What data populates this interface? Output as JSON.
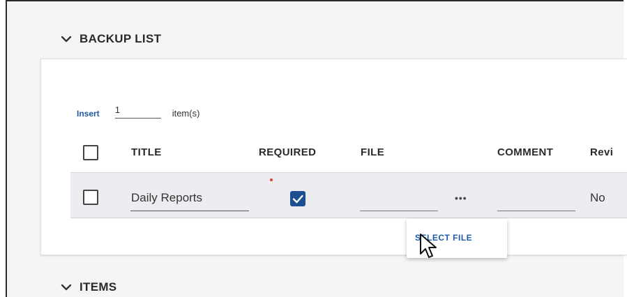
{
  "sections": {
    "backup_list": {
      "title": "BACKUP LIST"
    },
    "items": {
      "title": "ITEMS"
    }
  },
  "toolbar": {
    "insert_label": "Insert",
    "quantity_value": "1",
    "items_suffix": "item(s)"
  },
  "table": {
    "headers": [
      "TITLE",
      "REQUIRED",
      "FILE",
      "COMMENT",
      "Revi"
    ],
    "rows": [
      {
        "title": "Daily Reports",
        "required": true,
        "file": "",
        "file_menu": "•••",
        "comment": "",
        "review": "No"
      }
    ]
  },
  "popup": {
    "select_file_label": "SELECT FILE"
  },
  "colors": {
    "accent": "#1e5aa8",
    "checkbox_checked": "#1b4f8f",
    "required_marker": "#e53935"
  },
  "icons": {
    "collapse": "chevron-down-icon",
    "cursor": "mouse-pointer-icon"
  }
}
